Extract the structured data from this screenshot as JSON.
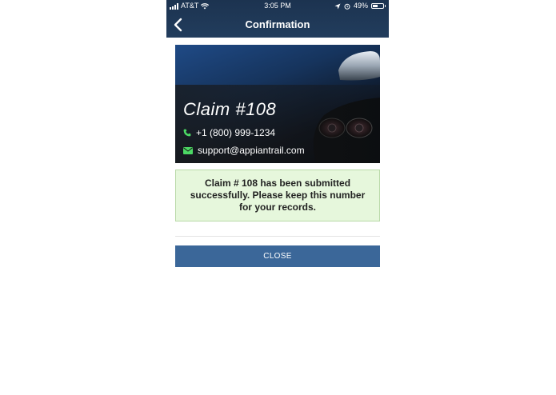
{
  "status_bar": {
    "carrier": "AT&T",
    "time": "3:05 PM",
    "battery_percent_text": "49%",
    "battery_level": 0.49
  },
  "nav": {
    "title": "Confirmation",
    "back_icon": "chevron-left-icon"
  },
  "hero": {
    "claim_title": "Claim #108",
    "phone": "+1 (800) 999-1234",
    "email": "support@appiantrail.com",
    "phone_icon": "phone-icon",
    "email_icon": "envelope-icon"
  },
  "message": {
    "text": "Claim # 108 has been submitted successfully. Please keep this number for your records."
  },
  "actions": {
    "close_label": "CLOSE"
  },
  "colors": {
    "header_bg": "#1c3350",
    "success_bg": "#e6f7dc",
    "success_border": "#b9d9a8",
    "button_bg": "#3b6799",
    "icon_green": "#4cd964"
  }
}
